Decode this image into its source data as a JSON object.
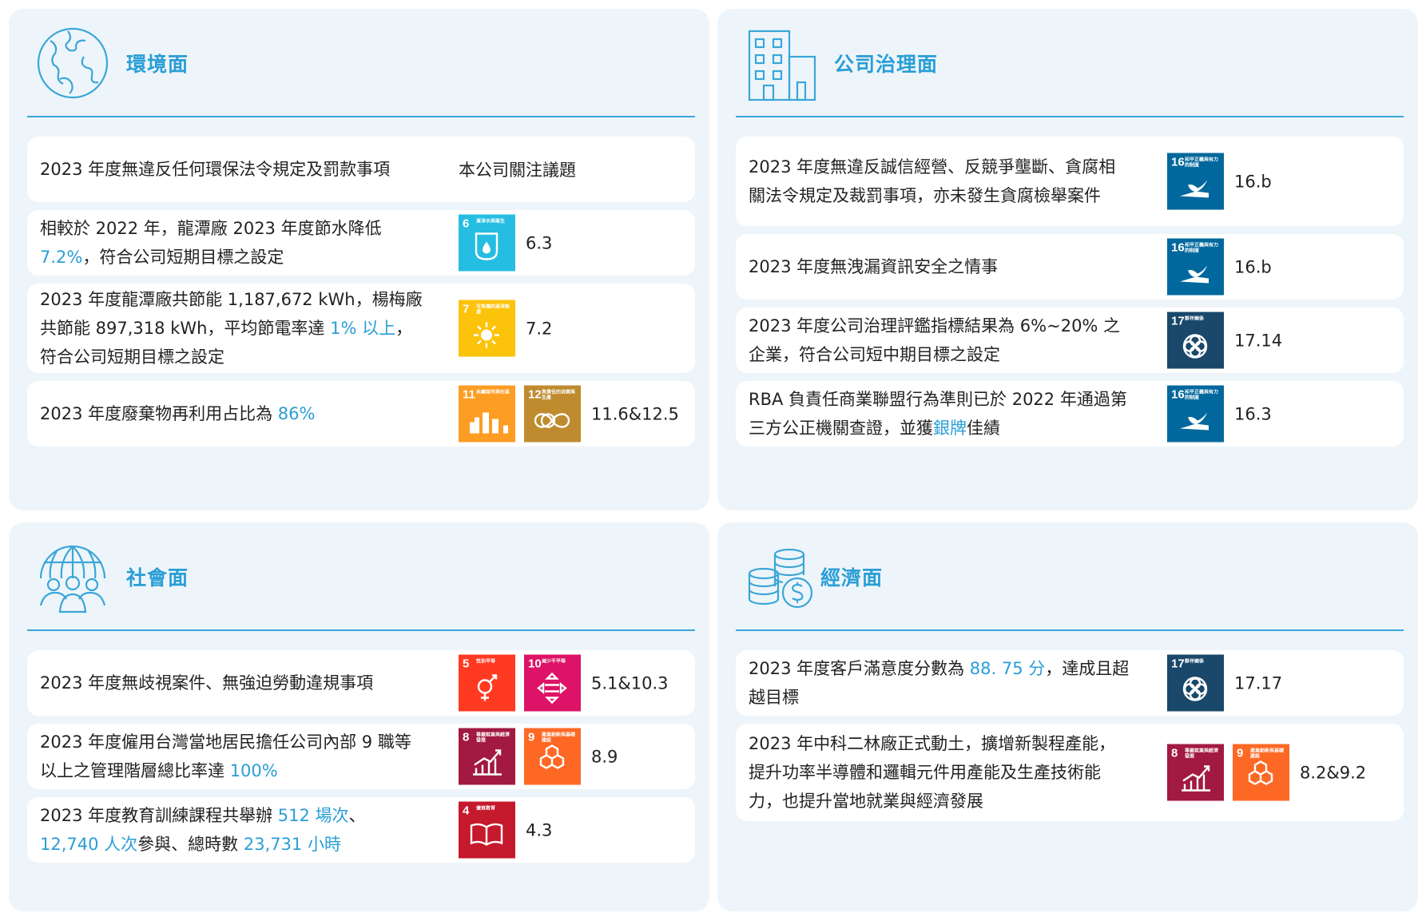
{
  "panels": {
    "env": {
      "title": "環境面",
      "focus_header": "本公司關注議題",
      "rows": [
        {
          "segments": [
            {
              "t": "2023 年度無違反任何環保法令規定及罰款事項",
              "hl": false
            }
          ],
          "sdgs": [],
          "target": ""
        },
        {
          "segments": [
            {
              "t": "相較於 2022 年，龍潭廠 2023 年度節水降低 ",
              "hl": false
            },
            {
              "t": "7.2%",
              "hl": true
            },
            {
              "t": "，符合公司短期目標之設定",
              "hl": false
            }
          ],
          "sdgs": [
            "6"
          ],
          "target": "6.3"
        },
        {
          "segments": [
            {
              "t": "2023 年度龍潭廠共節能 1,187,672 kWh，楊梅廠共節能 897,318 kWh，平均節電率達 ",
              "hl": false
            },
            {
              "t": "1% 以上",
              "hl": true
            },
            {
              "t": "，符合公司短期目標之設定",
              "hl": false
            }
          ],
          "sdgs": [
            "7"
          ],
          "target": "7.2"
        },
        {
          "segments": [
            {
              "t": "2023 年度廢棄物再利用占比為 ",
              "hl": false
            },
            {
              "t": "86%",
              "hl": true
            }
          ],
          "sdgs": [
            "11",
            "12"
          ],
          "target": "11.6&12.5"
        }
      ]
    },
    "gov": {
      "title": "公司治理面",
      "rows": [
        {
          "segments": [
            {
              "t": "2023 年度無違反誠信經營、反競爭壟斷、貪腐相關法令規定及裁罰事項，亦未發生貪腐檢舉案件",
              "hl": false
            }
          ],
          "sdgs": [
            "16"
          ],
          "target": "16.b"
        },
        {
          "segments": [
            {
              "t": "2023 年度無洩漏資訊安全之情事",
              "hl": false
            }
          ],
          "sdgs": [
            "16"
          ],
          "target": "16.b"
        },
        {
          "segments": [
            {
              "t": "2023 年度公司治理評鑑指標結果為 6%~20% 之企業，符合公司短中期目標之設定",
              "hl": false
            }
          ],
          "sdgs": [
            "17"
          ],
          "target": "17.14"
        },
        {
          "segments": [
            {
              "t": "RBA 負責任商業聯盟行為準則已於 2022 年通過第三方公正機關查證，並獲",
              "hl": false
            },
            {
              "t": "銀牌",
              "hl": true
            },
            {
              "t": "佳績",
              "hl": false
            }
          ],
          "sdgs": [
            "16"
          ],
          "target": "16.3"
        }
      ]
    },
    "soc": {
      "title": "社會面",
      "rows": [
        {
          "segments": [
            {
              "t": "2023 年度無歧視案件、無強迫勞動違規事項",
              "hl": false
            }
          ],
          "sdgs": [
            "5",
            "10"
          ],
          "target": "5.1&10.3"
        },
        {
          "segments": [
            {
              "t": "2023 年度僱用台灣當地居民擔任公司內部 9 職等以上之管理階層總比率達 ",
              "hl": false
            },
            {
              "t": "100%",
              "hl": true
            }
          ],
          "sdgs": [
            "8",
            "9"
          ],
          "target": "8.9"
        },
        {
          "segments": [
            {
              "t": "2023 年度教育訓練課程共舉辦 ",
              "hl": false
            },
            {
              "t": "512 場次",
              "hl": true
            },
            {
              "t": "、",
              "hl": false
            },
            {
              "t": "12,740 人次",
              "hl": true
            },
            {
              "t": "參與、總時數 ",
              "hl": false
            },
            {
              "t": "23,731 小時",
              "hl": true
            }
          ],
          "sdgs": [
            "4"
          ],
          "target": "4.3"
        }
      ]
    },
    "eco": {
      "title": "經濟面",
      "rows": [
        {
          "segments": [
            {
              "t": "2023 年度客戶滿意度分數為 ",
              "hl": false
            },
            {
              "t": "88. 75 分",
              "hl": true
            },
            {
              "t": "，達成且超越目標",
              "hl": false
            }
          ],
          "sdgs": [
            "17"
          ],
          "target": "17.17"
        },
        {
          "segments": [
            {
              "t": "2023 年中科二林廠正式動土，擴增新製程產能，提升功率半導體和邏輯元件用產能及生產技術能力，也提升當地就業與經濟發展",
              "hl": false
            }
          ],
          "sdgs": [
            "8",
            "9"
          ],
          "target": "8.2&9.2"
        }
      ]
    }
  },
  "sdg_goals": {
    "4": {
      "caption": "優質教育",
      "color": "#c5192d",
      "icon": "book-icon"
    },
    "5": {
      "caption": "性別平等",
      "color": "#ff3a21",
      "icon": "gender-icon"
    },
    "6": {
      "caption": "潔淨水與衛生",
      "color": "#26bde2",
      "icon": "water-icon"
    },
    "7": {
      "caption": "可負擔的潔淨能源",
      "color": "#fcc30b",
      "icon": "sun-icon"
    },
    "8": {
      "caption": "尊嚴就業與經濟發展",
      "color": "#a21942",
      "icon": "growth-chart-icon"
    },
    "9": {
      "caption": "產業創新與基礎建設",
      "color": "#fd6925",
      "icon": "cubes-icon"
    },
    "10": {
      "caption": "減少不平等",
      "color": "#dd1367",
      "icon": "equality-icon"
    },
    "11": {
      "caption": "永續城市與社區",
      "color": "#fd9d24",
      "icon": "city-icon"
    },
    "12": {
      "caption": "負責任的消費與生產",
      "color": "#bf8b2e",
      "icon": "infinity-icon"
    },
    "16": {
      "caption": "和平正義與有力的制度",
      "color": "#00689d",
      "icon": "dove-icon"
    },
    "17": {
      "caption": "夥伴關係",
      "color": "#19486a",
      "icon": "rings-icon"
    }
  },
  "icons": {
    "env": "globe-icon",
    "gov": "building-icon",
    "soc": "people-globe-icon",
    "eco": "coins-dollar-icon"
  },
  "colors": {
    "accent": "#2a9ed6",
    "panel_bg": "#eef5fa",
    "row_bg": "#ffffff"
  }
}
